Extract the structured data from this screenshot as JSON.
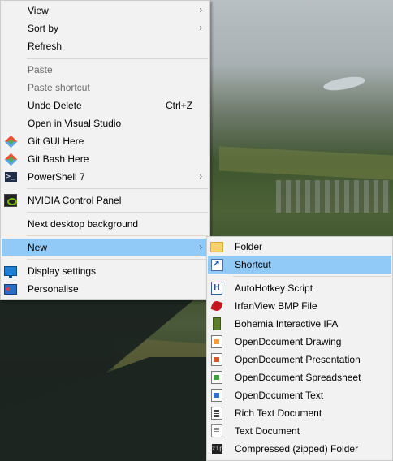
{
  "main_menu": {
    "items": [
      {
        "label": "View",
        "has_submenu": true
      },
      {
        "label": "Sort by",
        "has_submenu": true
      },
      {
        "label": "Refresh"
      },
      {
        "label": "Paste",
        "disabled": true
      },
      {
        "label": "Paste shortcut",
        "disabled": true
      },
      {
        "label": "Undo Delete",
        "shortcut": "Ctrl+Z"
      },
      {
        "label": "Open in Visual Studio"
      },
      {
        "label": "Git GUI Here",
        "icon": "git-icon"
      },
      {
        "label": "Git Bash Here",
        "icon": "git-icon"
      },
      {
        "label": "PowerShell 7",
        "icon": "powershell-icon",
        "has_submenu": true
      },
      {
        "label": "NVIDIA Control Panel",
        "icon": "nvidia-icon"
      },
      {
        "label": "Next desktop background"
      },
      {
        "label": "New",
        "has_submenu": true,
        "highlighted": true
      },
      {
        "label": "Display settings",
        "icon": "display-icon"
      },
      {
        "label": "Personalise",
        "icon": "personalise-icon"
      }
    ],
    "arrow_glyph": "›"
  },
  "new_submenu": {
    "items": [
      {
        "label": "Folder",
        "icon": "folder-icon"
      },
      {
        "label": "Shortcut",
        "icon": "shortcut-icon",
        "highlighted": true
      },
      {
        "label": "AutoHotkey Script",
        "icon": "autohotkey-icon"
      },
      {
        "label": "IrfanView BMP File",
        "icon": "irfanview-icon"
      },
      {
        "label": "Bohemia Interactive IFA",
        "icon": "bohemia-icon"
      },
      {
        "label": "OpenDocument Drawing",
        "icon": "odg-icon"
      },
      {
        "label": "OpenDocument Presentation",
        "icon": "odp-icon"
      },
      {
        "label": "OpenDocument Spreadsheet",
        "icon": "ods-icon"
      },
      {
        "label": "OpenDocument Text",
        "icon": "odt-icon"
      },
      {
        "label": "Rich Text Document",
        "icon": "rtf-icon"
      },
      {
        "label": "Text Document",
        "icon": "text-document-icon"
      },
      {
        "label": "Compressed (zipped) Folder",
        "icon": "zip-folder-icon"
      }
    ],
    "ahk_glyph": "H",
    "zip_glyph": "zip",
    "ps_glyph": ">_"
  },
  "colors": {
    "menu_background": "#f2f2f2",
    "highlight": "#91c9f7",
    "disabled_text": "#6d6d6d"
  }
}
